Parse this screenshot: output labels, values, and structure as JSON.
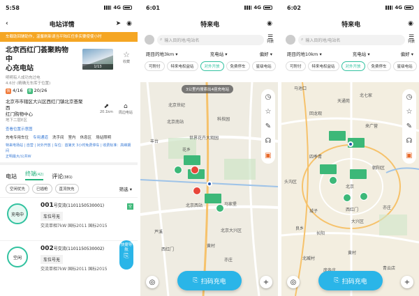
{
  "p1": {
    "time": "5:58",
    "net": "4G",
    "title": "电站详情",
    "notice": "车载助回辅助作，温馨刷新请当平陆红任条实要使使小时",
    "station_line1": "北京西红门荟聚购物中",
    "station_line2": "心充电站",
    "photo_count": "1/13",
    "fav": "收藏",
    "sub1": "明明有人成功充过电",
    "sub2": "4.6分 (精确无车库于位置)",
    "fast_label": "快",
    "fast_val": "4/16",
    "slow_label": "慢",
    "slow_val": "20/26",
    "addr1": "北京市市辖区大兴区西红门镇北京荟聚西",
    "addr2": "红门购物中心",
    "addr3": "地下二层E区",
    "distance": "20.1km",
    "nav_label": "周边电站",
    "view_photos": "查看位置示意图",
    "feat": [
      "充电专用车位",
      "专用通道",
      "洗手间",
      "室内",
      "休息区"
    ],
    "feat2": "场站照明",
    "fees": "特来电场站 | 自营 | 对外开放 | 车位：首第天 3小时免费停车 | 收费标准：高峰期间",
    "fee_link": "正明最大/公共W",
    "tabs": [
      "电站",
      "终端",
      "评论"
    ],
    "tab_counts": [
      "(42)",
      "(381)"
    ],
    "chips": [
      "空闲优先",
      "已插枪",
      "直流快充"
    ],
    "filter": "筛选",
    "cards": [
      {
        "status": "充电中",
        "num": "001",
        "numsuf": "号交流(1101150530001)",
        "field": "车位号无",
        "info": "交流单相7kW    国标2011  国标2015",
        "tag": "空"
      },
      {
        "status": "空闲",
        "num": "002",
        "numsuf": "号交流(1101150530002)",
        "field": "车位号无",
        "info": "交流单相7kW    国标2011  国标2015",
        "tag": ""
      }
    ],
    "quicknav": "快捷导航"
  },
  "p2": {
    "time": "6:01",
    "net": "4G",
    "title": "特来电",
    "search_ph": "输入目的地/电站名",
    "list": "列表",
    "drop1": "距目的地3km",
    "drop2": "充电站",
    "drop3": "偏好",
    "chips": [
      "可附付",
      "特来电权益站",
      "对外开放",
      "免费停车",
      "星级电站"
    ],
    "active_chip": 2,
    "tip": "3公里内搜索出4座充电站",
    "labels": [
      "北京世纪",
      "北京南站",
      "丰台",
      "科技园",
      "世界花卉大观园",
      "花乡",
      "北京西站",
      "芦溪",
      "北京大兴区",
      "马家堡",
      "西红门",
      "亦庄",
      "黄村"
    ],
    "scan": "扫码充电"
  },
  "p3": {
    "time": "6:02",
    "net": "4G",
    "title": "特来电",
    "search_ph": "输入目的地/电站名",
    "list": "列表",
    "drop1": "距目的地10km",
    "drop2": "充电站",
    "drop3": "偏好",
    "chips": [
      "可附付",
      "特来电权益站",
      "对外开放",
      "免费停车",
      "星级电站"
    ],
    "active_chip": 2,
    "labels": [
      "马池口",
      "北七家",
      "天通苑",
      "回龙观",
      "来广营",
      "亦庄",
      "四季青",
      "头沟区",
      "朝阳区",
      "北京",
      "城子",
      "大兴区",
      "良乡",
      "长阳",
      "西红门",
      "黄村",
      "北臧村",
      "青云店",
      "庞各庄"
    ],
    "scan": "扫码充电"
  },
  "icons": [
    "back-icon",
    "location-arrow-icon",
    "target-icon",
    "search-icon",
    "list-icon",
    "clock-icon",
    "star-icon",
    "pen-icon",
    "headset-icon",
    "gift-icon",
    "locate-icon",
    "plus-icon",
    "scan-icon"
  ],
  "colors": {
    "accent": "#20b07a",
    "blue": "#2ab5e8",
    "notice": "#f5a623"
  }
}
